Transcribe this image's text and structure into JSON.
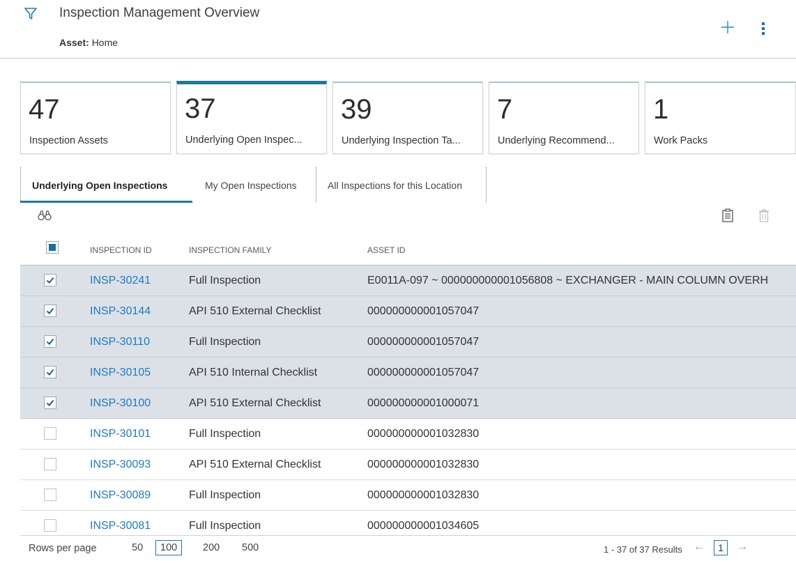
{
  "header": {
    "title": "Inspection Management Overview",
    "asset_label": "Asset:",
    "asset_value": "Home"
  },
  "cards": [
    {
      "value": "47",
      "label": "Inspection Assets"
    },
    {
      "value": "37",
      "label": "Underlying Open Inspec..."
    },
    {
      "value": "39",
      "label": "Underlying Inspection Ta..."
    },
    {
      "value": "7",
      "label": "Underlying Recommend..."
    },
    {
      "value": "1",
      "label": "Work Packs"
    }
  ],
  "tabs": [
    {
      "label": "Underlying Open Inspections"
    },
    {
      "label": "My Open Inspections"
    },
    {
      "label": "All Inspections for this Location"
    }
  ],
  "table": {
    "columns": [
      "INSPECTION ID",
      "INSPECTION FAMILY",
      "ASSET ID"
    ],
    "rows": [
      {
        "id": "INSP-30241",
        "family": "Full Inspection",
        "asset": "E0011A-097 ~ 000000000001056808 ~ EXCHANGER - MAIN COLUMN OVERH",
        "checked": true
      },
      {
        "id": "INSP-30144",
        "family": "API 510 External Checklist",
        "asset": "000000000001057047",
        "checked": true
      },
      {
        "id": "INSP-30110",
        "family": "Full Inspection",
        "asset": "000000000001057047",
        "checked": true
      },
      {
        "id": "INSP-30105",
        "family": "API 510 Internal Checklist",
        "asset": "000000000001057047",
        "checked": true
      },
      {
        "id": "INSP-30100",
        "family": "API 510 External Checklist",
        "asset": "000000000001000071",
        "checked": true
      },
      {
        "id": "INSP-30101",
        "family": "Full Inspection",
        "asset": "000000000001032830",
        "checked": false
      },
      {
        "id": "INSP-30093",
        "family": "API 510 External Checklist",
        "asset": "000000000001032830",
        "checked": false
      },
      {
        "id": "INSP-30089",
        "family": "Full Inspection",
        "asset": "000000000001032830",
        "checked": false
      },
      {
        "id": "INSP-30081",
        "family": "Full Inspection",
        "asset": "000000000001034605",
        "checked": false
      }
    ]
  },
  "pager": {
    "rows_per_page_label": "Rows per page",
    "options": [
      "50",
      "100",
      "200",
      "500"
    ],
    "selected_option": "100",
    "results_text": "1 - 37 of 37 Results",
    "current_page": "1"
  },
  "colors": {
    "accent": "#1a7a9e",
    "link": "#1f7ac2",
    "selected_row": "#dbe1e7"
  }
}
